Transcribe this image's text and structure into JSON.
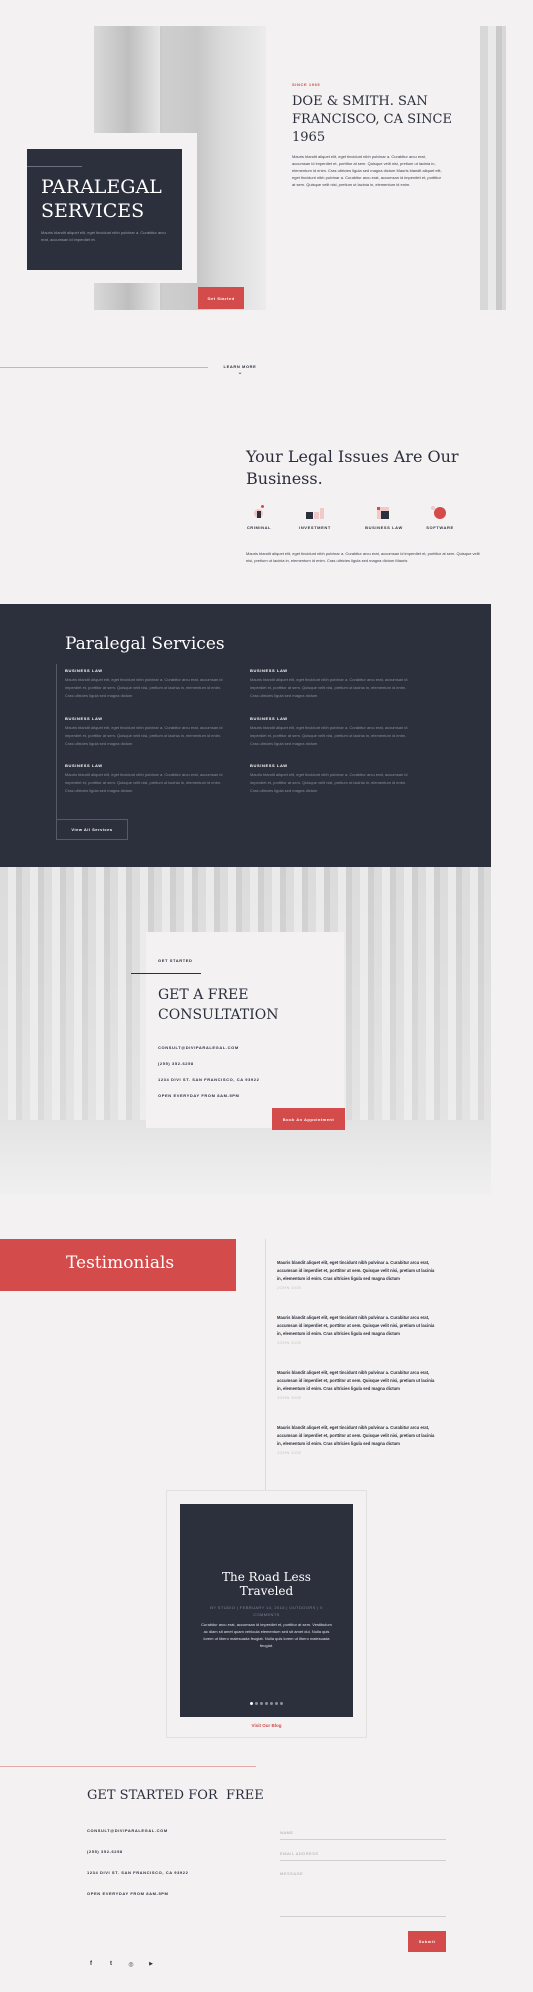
{
  "hero": {
    "title": "PARALEGAL SERVICES",
    "text": "Mauris blandit aliquet elit, eget tincidunt nibh pulvinar a. Curabitur arcu erat, accumsan id imperdiet et.",
    "button": "Get Started",
    "since_label": "SINCE 1965",
    "heading": "DOE & SMITH. SAN FRANCISCO, CA SINCE 1965",
    "body": "Mauris blandit aliquet elit, eget tincidunt nibh pulvinar a. Curabitur arcu erat, accumsan id imperdiet et, porttitor at sem. Quisque velit nisi, pretium ut lacinia in, elementum id enim. Cras ultricies ligula sed magna dictum Mauris blandit aliquet elit, eget tincidunt nibh pulvinar a. Curabitur arcu erat, accumsan id imperdiet et, porttitor at sem. Quisque velit nisi, pretium ut lacinia in, elementum id enim.",
    "learn_more": "LEARN MORE"
  },
  "legal": {
    "heading": "Your Legal Issues Are Our Business.",
    "areas": [
      {
        "label": "CRIMINAL",
        "icon": "criminal-icon"
      },
      {
        "label": "INVESTMENT",
        "icon": "investment-icon"
      },
      {
        "label": "BUSINESS LAW",
        "icon": "business-law-icon"
      },
      {
        "label": "SOFTWARE",
        "icon": "software-icon"
      }
    ],
    "text": "Mauris blandit aliquet elit, eget tincidunt nibh pulvinar a. Curabitur arcu erat, accumsan id imperdiet et, porttitor at sem. Quisque velit nisi, pretium ut lacinia in, elementum id enim. Cras ultricies ligula sed magna dictum Mauris"
  },
  "services": {
    "heading": "Paralegal Services",
    "items": [
      {
        "title": "BUSINESS LAW",
        "text": "Mauris blandit aliquet elit, eget tincidunt nibh pulvinar a. Curabitur arcu erat, accumsan id imperdiet et, porttitor at sem. Quisque velit nisi, pretium ut lacinia in, elementum id enim. Cras ultricies ligula sed magna dictum"
      },
      {
        "title": "BUSINESS LAW",
        "text": "Mauris blandit aliquet elit, eget tincidunt nibh pulvinar a. Curabitur arcu erat, accumsan id imperdiet et, porttitor at sem. Quisque velit nisi, pretium ut lacinia in, elementum id enim. Cras ultricies ligula sed magna dictum"
      },
      {
        "title": "BUSINESS LAW",
        "text": "Mauris blandit aliquet elit, eget tincidunt nibh pulvinar a. Curabitur arcu erat, accumsan id imperdiet et, porttitor at sem. Quisque velit nisi, pretium ut lacinia in, elementum id enim. Cras ultricies ligula sed magna dictum"
      },
      {
        "title": "BUSINESS LAW",
        "text": "Mauris blandit aliquet elit, eget tincidunt nibh pulvinar a. Curabitur arcu erat, accumsan id imperdiet et, porttitor at sem. Quisque velit nisi, pretium ut lacinia in, elementum id enim. Cras ultricies ligula sed magna dictum"
      },
      {
        "title": "BUSINESS LAW",
        "text": "Mauris blandit aliquet elit, eget tincidunt nibh pulvinar a. Curabitur arcu erat, accumsan id imperdiet et, porttitor at sem. Quisque velit nisi, pretium ut lacinia in, elementum id enim. Cras ultricies ligula sed magna dictum"
      },
      {
        "title": "BUSINESS LAW",
        "text": "Mauris blandit aliquet elit, eget tincidunt nibh pulvinar a. Curabitur arcu erat, accumsan id imperdiet et, porttitor at sem. Quisque velit nisi, pretium ut lacinia in, elementum id enim. Cras ultricies ligula sed magna dictum"
      }
    ],
    "button": "View All Services"
  },
  "consult": {
    "label": "GET STARTED",
    "heading": "GET A FREE CONSULTATION",
    "email": "CONSULT@DIVIPARALEGAL.COM",
    "phone": "(255) 352-6258",
    "address": "1234 DIVI ST. SAN FRANCISCO, CA 93922",
    "hours": "OPEN EVERYDAY FROM 8AM-5PM",
    "button": "Book An Appointment"
  },
  "testimonials": {
    "heading": "Testimonials",
    "items": [
      {
        "text": "Mauris blandit aliquet elit, eget tincidunt nibh pulvinar a. Curabitur arcu erat, accumsan id imperdiet et, porttitor at sem. Quisque velit nisi, pretium ut lacinia in, elementum id enim. Cras ultricies ligula sed magna dictum",
        "name": "JOHN DOE"
      },
      {
        "text": "Mauris blandit aliquet elit, eget tincidunt nibh pulvinar a. Curabitur arcu erat, accumsan id imperdiet et, porttitor at sem. Quisque velit nisi, pretium ut lacinia in, elementum id enim. Cras ultricies ligula sed magna dictum",
        "name": "JOHN DOE"
      },
      {
        "text": "Mauris blandit aliquet elit, eget tincidunt nibh pulvinar a. Curabitur arcu erat, accumsan id imperdiet et, porttitor at sem. Quisque velit nisi, pretium ut lacinia in, elementum id enim. Cras ultricies ligula sed magna dictum",
        "name": "JOHN DOE"
      },
      {
        "text": "Mauris blandit aliquet elit, eget tincidunt nibh pulvinar a. Curabitur arcu erat, accumsan id imperdiet et, porttitor at sem. Quisque velit nisi, pretium ut lacinia in, elementum id enim. Cras ultricies ligula sed magna dictum",
        "name": "JOHN DOE"
      }
    ]
  },
  "blog": {
    "title": "The Road Less Traveled",
    "meta": "BY STUDIO | FEBRUARY 14, 2018 | OUTDOORS | 0 COMMENTS",
    "text": "Curabitur arcu erat, accumsan id imperdiet et, porttitor at sem. Vestibulum ac diam sit amet quam vehicula elementum sed sit amet dui. Nulla quis lorem ut libero malesuada feugiat. Nulla quis lorem ut libero malesuada feugiat.",
    "link": "Visit Our Blog"
  },
  "footer": {
    "heading": "GET STARTED FOR  FREE",
    "email": "CONSULT@DIVIPARALEGAL.COM",
    "phone": "(255) 352-6258",
    "address": "1234 DIVI ST. SAN FRANCISCO, CA 93922",
    "hours": "OPEN EVERYDAY FROM 8AM-5PM",
    "name_placeholder": "NAME",
    "email_placeholder": "EMAIL ADDRESS",
    "message_placeholder": "MESSAGE",
    "submit": "Submit",
    "social": [
      {
        "icon": "facebook-icon",
        "glyph": "f"
      },
      {
        "icon": "twitter-icon",
        "glyph": "t"
      },
      {
        "icon": "instagram-icon",
        "glyph": "◎"
      },
      {
        "icon": "youtube-icon",
        "glyph": "▶"
      }
    ]
  },
  "colors": {
    "accent": "#d34b4b",
    "dark": "#2c2f3c",
    "background": "#f3f1f1"
  }
}
